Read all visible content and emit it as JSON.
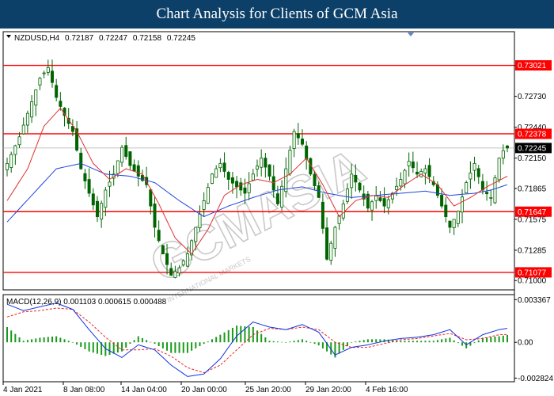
{
  "banner": {
    "title": "Chart Analysis for Clients of GCM Asia"
  },
  "watermark": {
    "text": "GCMASIA",
    "tagline": "INTERNATIONAL MARKETS"
  },
  "colors": {
    "banner_bg": "#0d4068",
    "resistance": "#ff0000",
    "badge": "#ff0000",
    "current_badge": "#000000",
    "candle": "#006400",
    "ma_fast": "#e03030",
    "ma_slow": "#2244dd",
    "macd_hist": "#1a9a1a",
    "macd_signal": "#ee2222",
    "macd_line": "#1133dd"
  },
  "chart_data": [
    {
      "type": "candlestick",
      "title": "",
      "header": {
        "symbol": "NZDUSD,H4",
        "open": "0.72187",
        "high": "0.72247",
        "low": "0.72158",
        "close": "0.72245"
      },
      "ylim": [
        0.7092,
        0.7333
      ],
      "yticks": [
        "0.73021",
        "0.72730",
        "0.72440",
        "0.72150",
        "0.71865",
        "0.71575",
        "0.71285",
        "0.71000"
      ],
      "xticks": [
        "4 Jan 2021",
        "8 Jan 08:00",
        "14 Jan 04:00",
        "20 Jan 00:00",
        "25 Jan 20:00",
        "29 Jan 20:00",
        "4 Feb 16:00"
      ],
      "horizontal_lines": [
        {
          "value": 0.73021,
          "label": "0.73021"
        },
        {
          "value": 0.72378,
          "label": "0.72378"
        },
        {
          "value": 0.71647,
          "label": "0.71647"
        },
        {
          "value": 0.71077,
          "label": "0.71077"
        }
      ],
      "current_price": {
        "value": 0.72245,
        "label": "0.72245"
      },
      "close_path": [
        [
          0,
          0.721
        ],
        [
          3,
          0.7235
        ],
        [
          6,
          0.7268
        ],
        [
          8,
          0.729
        ],
        [
          10,
          0.73
        ],
        [
          12,
          0.7272
        ],
        [
          14,
          0.7255
        ],
        [
          16,
          0.724
        ],
        [
          18,
          0.7205
        ],
        [
          20,
          0.7182
        ],
        [
          22,
          0.716
        ],
        [
          24,
          0.7185
        ],
        [
          26,
          0.72
        ],
        [
          28,
          0.7225
        ],
        [
          30,
          0.7208
        ],
        [
          32,
          0.7198
        ],
        [
          34,
          0.719
        ],
        [
          36,
          0.715
        ],
        [
          38,
          0.7125
        ],
        [
          40,
          0.7105
        ],
        [
          42,
          0.7112
        ],
        [
          44,
          0.7125
        ],
        [
          46,
          0.715
        ],
        [
          48,
          0.7175
        ],
        [
          50,
          0.72
        ],
        [
          52,
          0.721
        ],
        [
          54,
          0.7195
        ],
        [
          56,
          0.7188
        ],
        [
          58,
          0.7182
        ],
        [
          60,
          0.72
        ],
        [
          62,
          0.7215
        ],
        [
          64,
          0.7198
        ],
        [
          66,
          0.7172
        ],
        [
          68,
          0.7205
        ],
        [
          70,
          0.724
        ],
        [
          72,
          0.7228
        ],
        [
          74,
          0.72
        ],
        [
          76,
          0.7178
        ],
        [
          78,
          0.712
        ],
        [
          80,
          0.715
        ],
        [
          82,
          0.7172
        ],
        [
          84,
          0.72
        ],
        [
          86,
          0.7185
        ],
        [
          88,
          0.7168
        ],
        [
          90,
          0.718
        ],
        [
          92,
          0.717
        ],
        [
          94,
          0.7182
        ],
        [
          96,
          0.7195
        ],
        [
          98,
          0.7212
        ],
        [
          100,
          0.72
        ],
        [
          102,
          0.7205
        ],
        [
          104,
          0.719
        ],
        [
          106,
          0.717
        ],
        [
          108,
          0.715
        ],
        [
          110,
          0.7165
        ],
        [
          112,
          0.7192
        ],
        [
          114,
          0.721
        ],
        [
          116,
          0.7185
        ],
        [
          118,
          0.7178
        ],
        [
          120,
          0.7215
        ],
        [
          121,
          0.7222
        ],
        [
          122,
          0.72245
        ]
      ],
      "ma_fast": [
        [
          0,
          0.7175
        ],
        [
          5,
          0.7205
        ],
        [
          9,
          0.7245
        ],
        [
          13,
          0.7262
        ],
        [
          17,
          0.724
        ],
        [
          21,
          0.721
        ],
        [
          25,
          0.7195
        ],
        [
          29,
          0.7205
        ],
        [
          33,
          0.72
        ],
        [
          37,
          0.7172
        ],
        [
          41,
          0.714
        ],
        [
          45,
          0.7125
        ],
        [
          49,
          0.7148
        ],
        [
          53,
          0.718
        ],
        [
          57,
          0.719
        ],
        [
          61,
          0.7195
        ],
        [
          65,
          0.7192
        ],
        [
          69,
          0.72
        ],
        [
          73,
          0.7215
        ],
        [
          77,
          0.719
        ],
        [
          81,
          0.716
        ],
        [
          85,
          0.7175
        ],
        [
          89,
          0.718
        ],
        [
          93,
          0.7178
        ],
        [
          97,
          0.719
        ],
        [
          101,
          0.72
        ],
        [
          105,
          0.719
        ],
        [
          109,
          0.717
        ],
        [
          113,
          0.7178
        ],
        [
          117,
          0.7188
        ],
        [
          122,
          0.7198
        ]
      ],
      "ma_slow": [
        [
          0,
          0.7155
        ],
        [
          6,
          0.718
        ],
        [
          12,
          0.7205
        ],
        [
          18,
          0.721
        ],
        [
          24,
          0.72
        ],
        [
          30,
          0.7198
        ],
        [
          36,
          0.7192
        ],
        [
          42,
          0.7175
        ],
        [
          48,
          0.716
        ],
        [
          54,
          0.717
        ],
        [
          60,
          0.7178
        ],
        [
          66,
          0.7185
        ],
        [
          72,
          0.7188
        ],
        [
          78,
          0.7182
        ],
        [
          84,
          0.7178
        ],
        [
          90,
          0.718
        ],
        [
          96,
          0.7182
        ],
        [
          102,
          0.7184
        ],
        [
          108,
          0.718
        ],
        [
          114,
          0.7182
        ],
        [
          118,
          0.7185
        ],
        [
          122,
          0.719
        ]
      ]
    },
    {
      "type": "macd",
      "title": "",
      "header": "MACD(12,26,9) 0.001103 0.000615 0.000488",
      "ylim": [
        -0.00305,
        0.0037
      ],
      "yticks": [
        "0.003367",
        "0.00",
        "-0.002824"
      ],
      "macd_line": [
        [
          0,
          0.003
        ],
        [
          4,
          0.0025
        ],
        [
          8,
          0.0028
        ],
        [
          12,
          0.0031
        ],
        [
          16,
          0.0026
        ],
        [
          20,
          0.001
        ],
        [
          24,
          -0.0005
        ],
        [
          28,
          -0.0012
        ],
        [
          32,
          -0.0002
        ],
        [
          36,
          -0.0006
        ],
        [
          40,
          -0.0018
        ],
        [
          44,
          -0.0027
        ],
        [
          48,
          -0.0025
        ],
        [
          52,
          -0.0013
        ],
        [
          56,
          0.0005
        ],
        [
          60,
          0.0016
        ],
        [
          64,
          0.0012
        ],
        [
          68,
          0.001
        ],
        [
          72,
          0.0014
        ],
        [
          76,
          0.0008
        ],
        [
          80,
          -0.001
        ],
        [
          84,
          -0.0004
        ],
        [
          88,
          -0.0002
        ],
        [
          92,
          0.0001
        ],
        [
          96,
          0.0003
        ],
        [
          100,
          0.0004
        ],
        [
          104,
          0.0006
        ],
        [
          108,
          0.001
        ],
        [
          112,
          -0.0002
        ],
        [
          116,
          0.0006
        ],
        [
          120,
          0.001
        ],
        [
          122,
          0.0011
        ]
      ],
      "signal_line": [
        [
          0,
          0.002
        ],
        [
          4,
          0.0024
        ],
        [
          8,
          0.0025
        ],
        [
          12,
          0.0027
        ],
        [
          16,
          0.0026
        ],
        [
          20,
          0.0016
        ],
        [
          24,
          0.0004
        ],
        [
          28,
          -0.0006
        ],
        [
          32,
          -0.0006
        ],
        [
          36,
          -0.0005
        ],
        [
          40,
          -0.0011
        ],
        [
          44,
          -0.002
        ],
        [
          48,
          -0.0024
        ],
        [
          52,
          -0.0018
        ],
        [
          56,
          -0.0006
        ],
        [
          60,
          0.0006
        ],
        [
          64,
          0.0011
        ],
        [
          68,
          0.001
        ],
        [
          72,
          0.0012
        ],
        [
          76,
          0.001
        ],
        [
          80,
          0.0
        ],
        [
          84,
          -0.0004
        ],
        [
          88,
          -0.0004
        ],
        [
          92,
          -0.0001
        ],
        [
          96,
          0.0002
        ],
        [
          100,
          0.0003
        ],
        [
          104,
          0.0005
        ],
        [
          108,
          0.0007
        ],
        [
          112,
          0.0002
        ],
        [
          116,
          0.0003
        ],
        [
          120,
          0.0006
        ],
        [
          122,
          0.00062
        ]
      ]
    }
  ]
}
